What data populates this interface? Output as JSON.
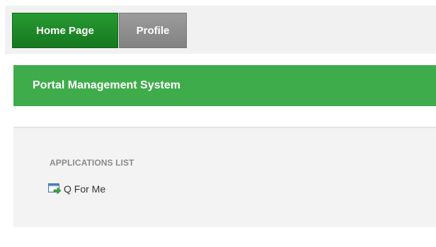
{
  "nav": {
    "tabs": [
      {
        "label": "Home Page",
        "active": true
      },
      {
        "label": "Profile",
        "active": false
      }
    ]
  },
  "banner": {
    "title": "Portal Management System"
  },
  "applications": {
    "heading": "APPLICATIONS LIST",
    "items": [
      {
        "label": "Q For Me",
        "icon": "window-arrow-icon"
      }
    ]
  },
  "colors": {
    "active_tab": "#1f8a2a",
    "inactive_tab": "#8f8f8f",
    "banner": "#3fac4b",
    "panel": "#f3f3f3"
  }
}
